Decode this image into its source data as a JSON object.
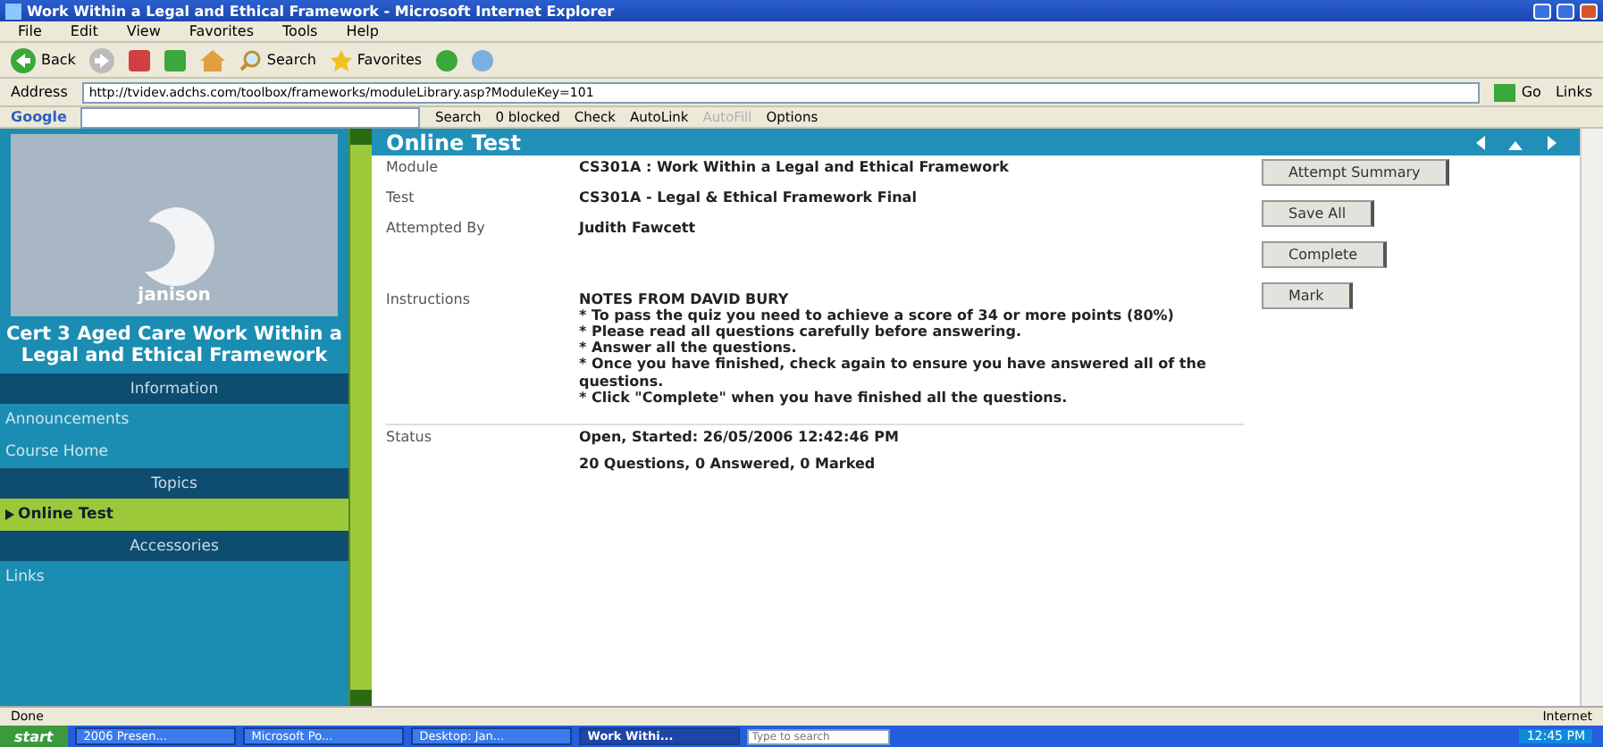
{
  "window": {
    "title": "Work Within a Legal and Ethical Framework - Microsoft Internet Explorer"
  },
  "menu": [
    "File",
    "Edit",
    "View",
    "Favorites",
    "Tools",
    "Help"
  ],
  "toolbar": {
    "back": "Back",
    "search": "Search",
    "favorites": "Favorites"
  },
  "address": {
    "label": "Address",
    "url": "http://tvidev.adchs.com/toolbox/frameworks/moduleLibrary.asp?ModuleKey=101",
    "go": "Go",
    "links": "Links"
  },
  "google_bar": {
    "label": "Google",
    "items": [
      {
        "label": "Search",
        "disabled": false
      },
      {
        "label": "0 blocked",
        "disabled": false
      },
      {
        "label": "Check",
        "disabled": false
      },
      {
        "label": "AutoLink",
        "disabled": false
      },
      {
        "label": "AutoFill",
        "disabled": true
      },
      {
        "label": "Options",
        "disabled": false
      }
    ]
  },
  "sidebar": {
    "logo": "janison",
    "course": "Cert 3 Aged Care Work Within a Legal and Ethical Framework",
    "items": [
      {
        "kind": "header",
        "label": "Information",
        "selected": false
      },
      {
        "kind": "link",
        "label": "Announcements",
        "selected": false
      },
      {
        "kind": "link",
        "label": "Course Home",
        "selected": false
      },
      {
        "kind": "header",
        "label": "Topics",
        "selected": false
      },
      {
        "kind": "link",
        "label": "Online Test",
        "selected": true
      },
      {
        "kind": "header",
        "label": "Accessories",
        "selected": false
      },
      {
        "kind": "link",
        "label": "Links",
        "selected": false
      }
    ]
  },
  "page": {
    "title": "Online Test",
    "rows": [
      {
        "label": "Module",
        "lines": [
          "CS301A : Work Within a Legal and Ethical Framework"
        ]
      },
      {
        "label": "Test",
        "lines": [
          "CS301A - Legal & Ethical Framework Final"
        ]
      },
      {
        "label": "Attempted By",
        "lines": [
          "Judith Fawcett"
        ]
      },
      {
        "label": "Instructions",
        "lines": [
          "NOTES FROM DAVID BURY",
          "* To pass the quiz you need to achieve a score of 34 or more points (80%)",
          "* Please read all questions carefully before answering.",
          "* Answer all the questions.",
          "* Once you have finished, check again to ensure you have answered all of the questions.",
          "* Click \"Complete\" when you have finished all the questions."
        ]
      },
      {
        "label": "Status",
        "lines": [
          "Open, Started: 26/05/2006 12:42:46 PM",
          "20 Questions, 0 Answered, 0 Marked"
        ]
      }
    ],
    "buttons": [
      "Attempt Summary",
      "Save All",
      "Complete",
      "Mark"
    ]
  },
  "status_bar": {
    "text": "Done",
    "zone": "Internet"
  },
  "taskbar": {
    "start": "start",
    "tasks": [
      {
        "label": "2006 Presen...",
        "selected": false
      },
      {
        "label": "Microsoft Po...",
        "selected": false
      },
      {
        "label": "Desktop: Jan...",
        "selected": false
      },
      {
        "label": "Work Withi...",
        "selected": true
      }
    ],
    "search_placeholder": "Type to search",
    "clock": "12:45 PM"
  }
}
